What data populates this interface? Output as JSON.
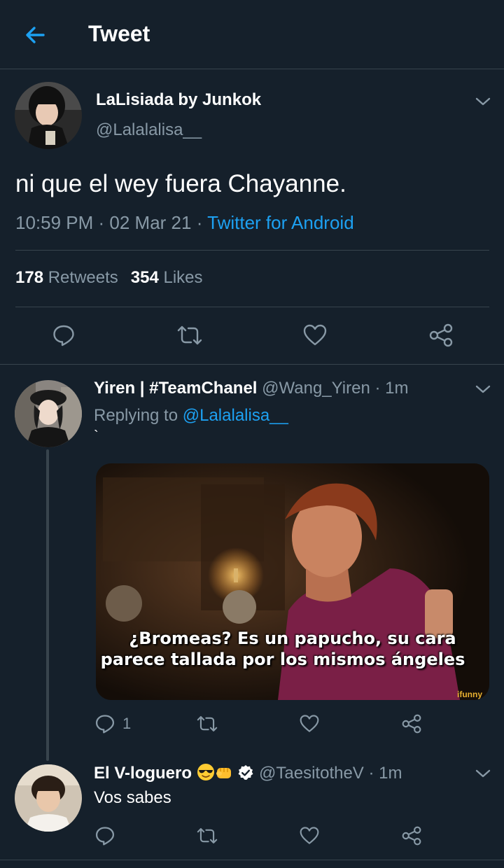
{
  "header": {
    "title": "Tweet",
    "back_icon": "arrow-left-icon"
  },
  "tweet": {
    "display_name": "LaLisiada by Junkok",
    "handle": "@Lalalalisa__",
    "text": "ni que el wey fuera Chayanne.",
    "time": "10:59 PM",
    "date": "02 Mar 21",
    "source": "Twitter for Android",
    "retweets_count": "178",
    "retweets_label": "Retweets",
    "likes_count": "354",
    "likes_label": "Likes"
  },
  "replies": [
    {
      "display_name": "Yiren | #TeamChanel",
      "handle": "@Wang_Yiren",
      "time": "1m",
      "replying_label": "Replying to",
      "replying_to": "@Lalalalisa__",
      "text": "`",
      "media_caption_1": "¿Bromeas? Es un papucho, su cara",
      "media_caption_2": "parece tallada por los mismos ángeles",
      "media_watermark": "ifunny",
      "reply_count": "1"
    },
    {
      "display_name": "El V-loguero",
      "name_emojis": [
        "sunglasses-emoji",
        "fist-emoji"
      ],
      "verified_icon": "verified-badge-icon",
      "handle": "@TaesitotheV",
      "time": "1m",
      "text": "Vos sabes"
    }
  ],
  "colors": {
    "background": "#15202b",
    "accent": "#1da1f2",
    "secondary_text": "#8899a6",
    "divider": "#38444d"
  }
}
